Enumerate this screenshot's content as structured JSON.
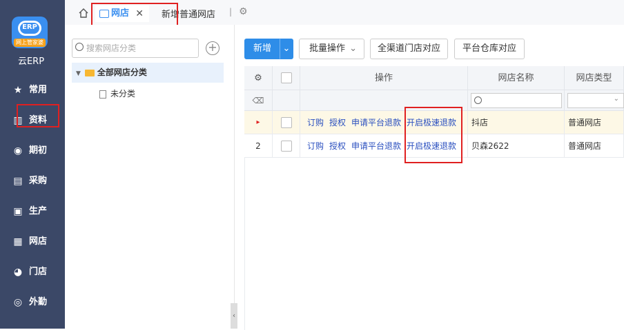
{
  "sidebar": {
    "logo_badge": "网上管家婆",
    "logo_text": "ERP",
    "app_name": "云ERP",
    "items": [
      {
        "label": "常用",
        "icon": "star-icon"
      },
      {
        "label": "资料",
        "icon": "data-icon"
      },
      {
        "label": "期初",
        "icon": "clock-icon"
      },
      {
        "label": "采购",
        "icon": "purchase-icon"
      },
      {
        "label": "生产",
        "icon": "production-icon"
      },
      {
        "label": "网店",
        "icon": "store-icon"
      },
      {
        "label": "门店",
        "icon": "shop-icon"
      },
      {
        "label": "外勤",
        "icon": "fieldwork-icon"
      }
    ]
  },
  "tabs": {
    "active": "网店",
    "close": "✕",
    "second": "新增普通网店",
    "separator": "|"
  },
  "left": {
    "search_placeholder": "搜索网店分类",
    "add": "+",
    "root": "全部网店分类",
    "child": "未分类"
  },
  "toolbar": {
    "new": "新增",
    "batch": "批量操作",
    "all_channel": "全渠道门店对应",
    "warehouse": "平台仓库对应"
  },
  "grid": {
    "headers": {
      "op": "操作",
      "name": "网店名称",
      "type": "网店类型"
    },
    "ops": [
      "订购",
      "授权",
      "申请平台退款",
      "开启极速退款"
    ],
    "rows": [
      {
        "idx": "▸",
        "name": "抖店",
        "type": "普通网店"
      },
      {
        "idx": "2",
        "name": "贝森2622",
        "type": "普通网店"
      }
    ]
  },
  "colors": {
    "accent": "#2e8de8",
    "sidebar": "#3b4867",
    "highlight": "#e02020",
    "link": "#2a4fbf"
  }
}
